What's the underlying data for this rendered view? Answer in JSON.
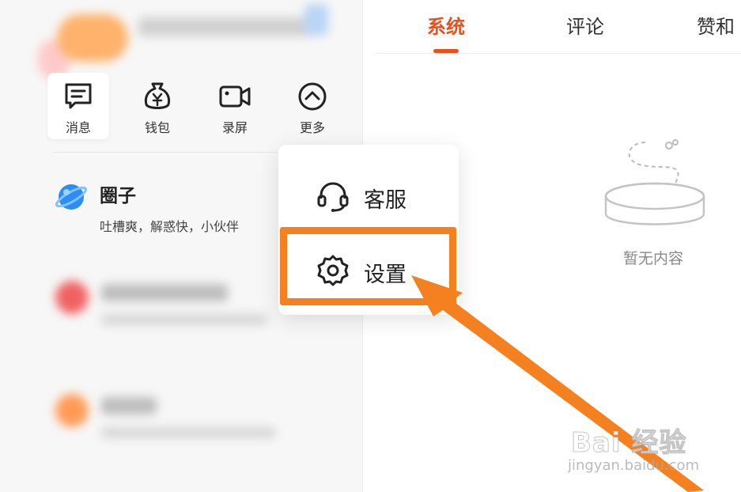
{
  "quick_actions": [
    {
      "label": "消息",
      "icon": "message-icon"
    },
    {
      "label": "钱包",
      "icon": "wallet-icon"
    },
    {
      "label": "录屏",
      "icon": "screen-record-icon"
    },
    {
      "label": "更多",
      "icon": "chevron-up-icon"
    }
  ],
  "circle": {
    "title": "圈子",
    "subtitle": "吐槽爽，解惑快，小伙伴"
  },
  "popup_menu": {
    "items": [
      {
        "label": "客服",
        "icon": "headset-icon"
      },
      {
        "label": "设置",
        "icon": "gear-icon"
      }
    ]
  },
  "tabs": [
    {
      "label": "系统",
      "active": true
    },
    {
      "label": "评论",
      "active": false
    },
    {
      "label": "赞和",
      "active": false
    }
  ],
  "empty_state": {
    "text": "暂无内容"
  },
  "watermark": {
    "main": "Bai 经验",
    "sub": "jingyan.baidu.com"
  },
  "colors": {
    "accent": "#e8511c",
    "highlight": "#f5801f"
  }
}
